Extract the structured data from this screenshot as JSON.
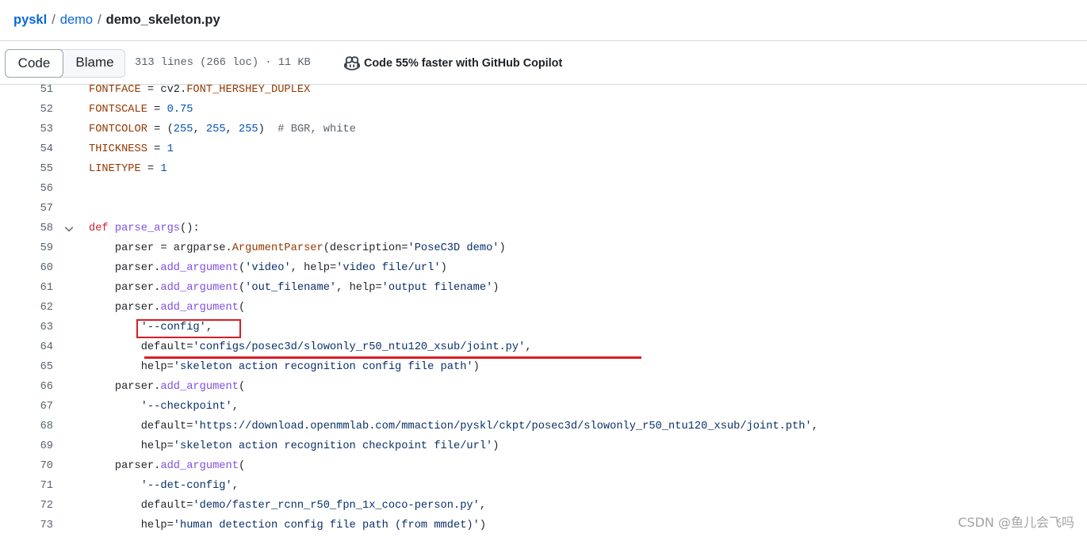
{
  "colors": {
    "link": "#0969da",
    "text": "#1f2328",
    "muted": "#59636e",
    "border": "#d1d9e0",
    "annotation": "#d81e25",
    "watermark": "#a3a3a3"
  },
  "icons": {
    "copilot": "copilot-icon",
    "fold": "chevron-down-icon"
  },
  "breadcrumb": {
    "repo": "pyskl",
    "separator": "/",
    "dir": "demo",
    "file": "demo_skeleton.py"
  },
  "toolbar": {
    "tabs": [
      {
        "label": "Code",
        "selected": true
      },
      {
        "label": "Blame",
        "selected": false
      }
    ],
    "file_info": "313 lines (266 loc) · 11 KB",
    "copilot_text": "Code 55% faster with GitHub Copilot"
  },
  "code": {
    "lines": [
      {
        "n": 51,
        "tokens": [
          {
            "t": "FONTFACE",
            "c": "#953800"
          },
          {
            "t": " = cv2."
          },
          {
            "t": "FONT_HERSHEY_DUPLEX",
            "c": "#953800"
          }
        ]
      },
      {
        "n": 52,
        "tokens": [
          {
            "t": "FONTSCALE",
            "c": "#953800"
          },
          {
            "t": " = "
          },
          {
            "t": "0.75",
            "c": "#0550ae"
          }
        ]
      },
      {
        "n": 53,
        "tokens": [
          {
            "t": "FONTCOLOR",
            "c": "#953800"
          },
          {
            "t": " = ("
          },
          {
            "t": "255",
            "c": "#0550ae"
          },
          {
            "t": ", "
          },
          {
            "t": "255",
            "c": "#0550ae"
          },
          {
            "t": ", "
          },
          {
            "t": "255",
            "c": "#0550ae"
          },
          {
            "t": ")  "
          },
          {
            "t": "# BGR, white",
            "c": "#59636e"
          }
        ]
      },
      {
        "n": 54,
        "tokens": [
          {
            "t": "THICKNESS",
            "c": "#953800"
          },
          {
            "t": " = "
          },
          {
            "t": "1",
            "c": "#0550ae"
          }
        ]
      },
      {
        "n": 55,
        "tokens": [
          {
            "t": "LINETYPE",
            "c": "#953800"
          },
          {
            "t": " = "
          },
          {
            "t": "1",
            "c": "#0550ae"
          }
        ]
      },
      {
        "n": 56,
        "tokens": []
      },
      {
        "n": 57,
        "tokens": []
      },
      {
        "n": 58,
        "fold": true,
        "tokens": [
          {
            "t": "def",
            "c": "#cf222e"
          },
          {
            "t": " "
          },
          {
            "t": "parse_args",
            "c": "#8250df"
          },
          {
            "t": "():"
          }
        ]
      },
      {
        "n": 59,
        "tokens": [
          {
            "t": "    parser = argparse."
          },
          {
            "t": "ArgumentParser",
            "c": "#953800"
          },
          {
            "t": "(description="
          },
          {
            "t": "'PoseC3D demo'",
            "c": "#0a3069"
          },
          {
            "t": ")"
          }
        ]
      },
      {
        "n": 60,
        "tokens": [
          {
            "t": "    parser."
          },
          {
            "t": "add_argument",
            "c": "#8250df"
          },
          {
            "t": "("
          },
          {
            "t": "'video'",
            "c": "#0a3069"
          },
          {
            "t": ", help="
          },
          {
            "t": "'video file/url'",
            "c": "#0a3069"
          },
          {
            "t": ")"
          }
        ]
      },
      {
        "n": 61,
        "tokens": [
          {
            "t": "    parser."
          },
          {
            "t": "add_argument",
            "c": "#8250df"
          },
          {
            "t": "("
          },
          {
            "t": "'out_filename'",
            "c": "#0a3069"
          },
          {
            "t": ", help="
          },
          {
            "t": "'output filename'",
            "c": "#0a3069"
          },
          {
            "t": ")"
          }
        ]
      },
      {
        "n": 62,
        "tokens": [
          {
            "t": "    parser."
          },
          {
            "t": "add_argument",
            "c": "#8250df"
          },
          {
            "t": "("
          }
        ]
      },
      {
        "n": 63,
        "tokens": [
          {
            "t": "        "
          },
          {
            "t": "'--config'",
            "c": "#0a3069"
          },
          {
            "t": ","
          }
        ]
      },
      {
        "n": 64,
        "tokens": [
          {
            "t": "        default="
          },
          {
            "t": "'configs/posec3d/slowonly_r50_ntu120_xsub/joint.py'",
            "c": "#0a3069"
          },
          {
            "t": ","
          }
        ]
      },
      {
        "n": 65,
        "tokens": [
          {
            "t": "        help="
          },
          {
            "t": "'skeleton action recognition config file path'",
            "c": "#0a3069"
          },
          {
            "t": ")"
          }
        ]
      },
      {
        "n": 66,
        "tokens": [
          {
            "t": "    parser."
          },
          {
            "t": "add_argument",
            "c": "#8250df"
          },
          {
            "t": "("
          }
        ]
      },
      {
        "n": 67,
        "tokens": [
          {
            "t": "        "
          },
          {
            "t": "'--checkpoint'",
            "c": "#0a3069"
          },
          {
            "t": ","
          }
        ]
      },
      {
        "n": 68,
        "tokens": [
          {
            "t": "        default="
          },
          {
            "t": "'https://download.openmmlab.com/mmaction/pyskl/ckpt/posec3d/slowonly_r50_ntu120_xsub/joint.pth'",
            "c": "#0a3069"
          },
          {
            "t": ","
          }
        ]
      },
      {
        "n": 69,
        "tokens": [
          {
            "t": "        help="
          },
          {
            "t": "'skeleton action recognition checkpoint file/url'",
            "c": "#0a3069"
          },
          {
            "t": ")"
          }
        ]
      },
      {
        "n": 70,
        "tokens": [
          {
            "t": "    parser."
          },
          {
            "t": "add_argument",
            "c": "#8250df"
          },
          {
            "t": "("
          }
        ]
      },
      {
        "n": 71,
        "tokens": [
          {
            "t": "        "
          },
          {
            "t": "'--det-config'",
            "c": "#0a3069"
          },
          {
            "t": ","
          }
        ]
      },
      {
        "n": 72,
        "tokens": [
          {
            "t": "        default="
          },
          {
            "t": "'demo/faster_rcnn_r50_fpn_1x_coco-person.py'",
            "c": "#0a3069"
          },
          {
            "t": ","
          }
        ]
      },
      {
        "n": 73,
        "tokens": [
          {
            "t": "        help="
          },
          {
            "t": "'human detection config file path (from mmdet)'",
            "c": "#0a3069"
          },
          {
            "t": ")"
          }
        ]
      }
    ]
  },
  "watermark": "CSDN @鱼儿会飞吗"
}
